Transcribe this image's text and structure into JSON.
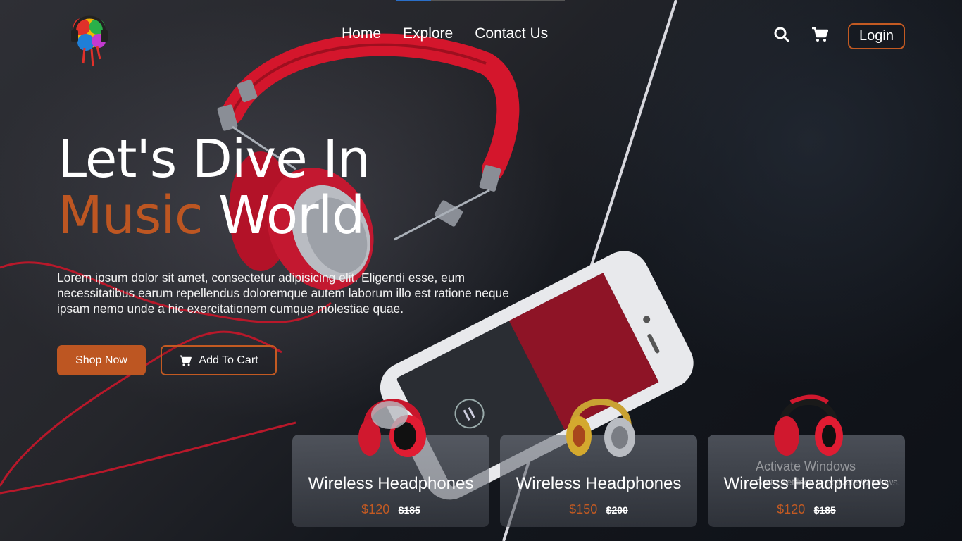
{
  "nav": {
    "items": [
      {
        "label": "Home"
      },
      {
        "label": "Explore"
      },
      {
        "label": "Contact Us"
      }
    ],
    "login_label": "Login"
  },
  "hero": {
    "title_line1": "Let's Dive In",
    "title_accent": "Music",
    "title_rest": " World",
    "description": "Lorem ipsum dolor sit amet, consectetur adipisicing elit. Eligendi esse, eum necessitatibus earum repellendus doloremque autem laborum illo est ratione neque ipsam nemo unde a hic exercitationem cumque molestiae quae.",
    "shop_button": "Shop Now",
    "cart_button": "Add To Cart"
  },
  "products": [
    {
      "name": "Wireless Headphones",
      "price": "$120",
      "old_price": "$185",
      "icon": "red-headphones"
    },
    {
      "name": "Wireless Headphones",
      "price": "$150",
      "old_price": "$200",
      "icon": "gold-headphones"
    },
    {
      "name": "Wireless Headphones",
      "price": "$120",
      "old_price": "$185",
      "icon": "red-black-headphones"
    }
  ],
  "watermark": {
    "line1": "Activate Windows",
    "line2": "Go to Settings to activate Windows."
  },
  "colors": {
    "accent": "#bd5622",
    "background": "#1c1d22",
    "text": "#ffffff"
  },
  "icons": [
    "logo-icon",
    "search-icon",
    "cart-icon"
  ]
}
